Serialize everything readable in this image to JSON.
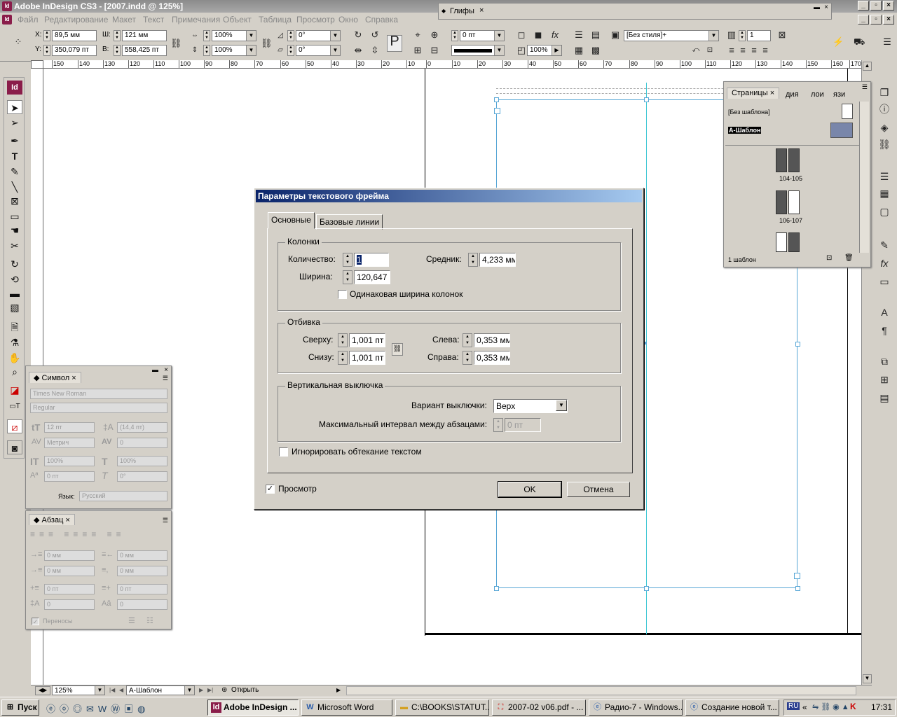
{
  "window": {
    "title": "Adobe InDesign CS3 - [2007.indd @ 125%]",
    "app_icon": "Id"
  },
  "menubar": {
    "items": [
      "Файл",
      "Редактирование",
      "Макет",
      "Текст",
      "Примечания",
      "Объект",
      "Таблица",
      "Просмотр",
      "Окно",
      "Справка"
    ]
  },
  "glyphs_panel": {
    "tab": "Глифы"
  },
  "control": {
    "x_label": "X:",
    "x_value": "89,5 мм",
    "y_label": "Y:",
    "y_value": "350,079 пт",
    "w_label": "Ш:",
    "w_value": "121 мм",
    "h_label": "В:",
    "h_value": "558,425 пт",
    "scale_x": "100%",
    "scale_y": "100%",
    "angle": "0°",
    "shear": "0°",
    "stroke": "0 пт",
    "opacity": "100%",
    "style": "[Без стиля]+",
    "columns": "1",
    "para_icon": "P"
  },
  "ruler": {
    "ticks": [
      "150",
      "140",
      "130",
      "120",
      "110",
      "100",
      "90",
      "80",
      "70",
      "60",
      "50",
      "40",
      "30",
      "20",
      "10",
      "0",
      "10",
      "20",
      "30",
      "40",
      "50",
      "60",
      "70",
      "80",
      "90",
      "100",
      "110",
      "120",
      "130",
      "140",
      "150",
      "160",
      "170"
    ]
  },
  "pages_panel": {
    "tab_pages": "Страницы",
    "tab_2": "дия",
    "tab_3": "лои",
    "tab_4": "язи",
    "no_master": "[Без шаблона]",
    "a_master": "А-Шаблон",
    "spread1": "104-105",
    "spread2": "106-107",
    "footer": "1 шаблон"
  },
  "character_panel": {
    "tab": "Символ",
    "font": "Times New Roman",
    "style": "Regular",
    "size": "12 пт",
    "leading": "(14,4 пт)",
    "kerning": "Метрич",
    "tracking": "0",
    "vscale": "100%",
    "hscale": "100%",
    "baseline": "0 пт",
    "skew": "0°",
    "lang_label": "Язык:",
    "lang": "Русский"
  },
  "paragraph_panel": {
    "tab": "Абзац",
    "left_indent": "0 мм",
    "right_indent": "0 мм",
    "first_indent": "0 мм",
    "last_indent": "0 мм",
    "space_before": "0 пт",
    "space_after": "0 пт",
    "dropcap_lines": "0",
    "dropcap_chars": "0",
    "hyphen": "Переносы"
  },
  "dialog": {
    "title": "Параметры текстового фрейма",
    "tab_basic": "Основные",
    "tab_baseline": "Базовые линии",
    "columns_group": "Колонки",
    "count_label": "Количество:",
    "count_value": "1",
    "gutter_label": "Средник:",
    "gutter_value": "4,233 мм",
    "width_label": "Ширина:",
    "width_value": "120,647",
    "fixed_width": "Одинаковая ширина колонок",
    "inset_group": "Отбивка",
    "top_label": "Сверху:",
    "top_value": "1,001 пт",
    "bottom_label": "Снизу:",
    "bottom_value": "1,001 пт",
    "left_label": "Слева:",
    "left_value": "0,353 мм",
    "right_label": "Справа:",
    "right_value": "0,353 мм",
    "vjust_group": "Вертикальная выключка",
    "align_label": "Вариант выключки:",
    "align_value": "Верх",
    "max_spacing_label": "Максимальный интервал между абзацами:",
    "max_spacing_value": "0 пт",
    "ignore_wrap": "Игнорировать обтекание текстом",
    "preview": "Просмотр",
    "ok": "OK",
    "cancel": "Отмена"
  },
  "status": {
    "zoom": "125%",
    "page": "А-Шаблон",
    "open": "Открыть"
  },
  "taskbar": {
    "start": "Пуск",
    "tasks": [
      "Adobe InDesign ...",
      "Microsoft Word",
      "C:\\BOOKS\\STATUT...",
      "2007-02 v06.pdf - ...",
      "Радио-7 - Windows...",
      "Создание новой т..."
    ],
    "lang": "RU",
    "time": "17:31"
  }
}
